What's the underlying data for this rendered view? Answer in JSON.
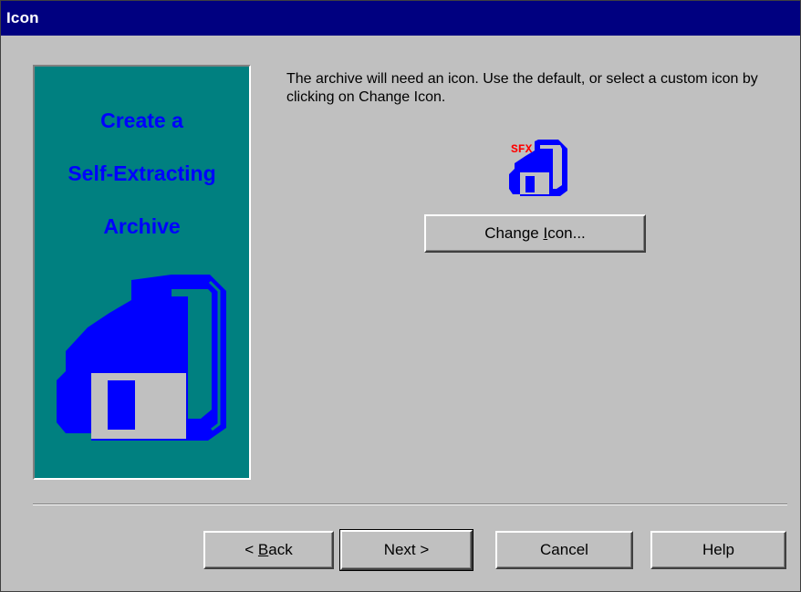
{
  "dialog": {
    "title": "Icon"
  },
  "banner": {
    "line1": "Create a",
    "line2": "Self-Extracting",
    "line3": "Archive",
    "background_color": "#008080",
    "text_color": "#0000ff",
    "icon": "floppy-disk-icon"
  },
  "main": {
    "instructions": "The archive will need an icon.  Use the default, or select a custom icon by clicking on Change Icon.",
    "sfx_icon": "sfx-floppy-icon",
    "sfx_label": "SFX",
    "change_icon_prefix": "Change ",
    "change_icon_mnemonic": "I",
    "change_icon_suffix": "con..."
  },
  "buttons": {
    "back_prefix": "< ",
    "back_mnemonic": "B",
    "back_suffix": "ack",
    "next": "Next >",
    "cancel": "Cancel",
    "help": "Help"
  },
  "colors": {
    "title_bar": "#000080",
    "dialog_bg": "#c0c0c0",
    "sfx_text": "#ff0000"
  }
}
